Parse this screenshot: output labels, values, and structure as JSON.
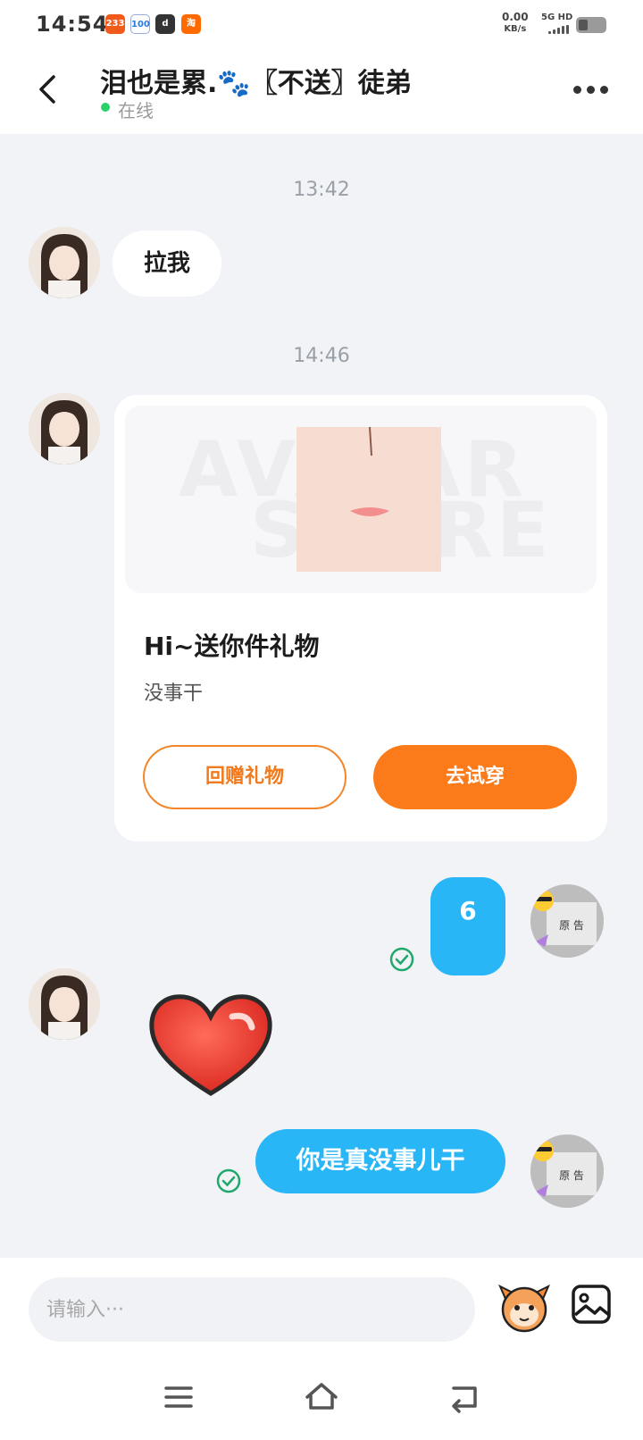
{
  "status_bar": {
    "time": "14:54",
    "apps": [
      "233",
      "100",
      "d",
      "淘"
    ],
    "net_speed_value": "0.00",
    "net_speed_unit": "KB/s",
    "signal_label": "5G HD",
    "battery_level": 0.25
  },
  "header": {
    "title": "泪也是累.🐾〖不送〗徒弟",
    "status": "在线"
  },
  "messages": {
    "time_1": "13:42",
    "msg_1_text": "拉我",
    "time_2": "14:46",
    "gift": {
      "banner_watermark_1": "AVATAR",
      "banner_watermark_2": "STORE",
      "title": "Hi~送你件礼物",
      "subtitle": "没事干",
      "return_gift_label": "回赠礼物",
      "try_on_label": "去试穿"
    },
    "msg_out_1": "6",
    "msg_out_2": "你是真没事儿干",
    "avatar_right_sign": "原 告"
  },
  "input_bar": {
    "placeholder": "请输入···"
  },
  "colors": {
    "accent_blue": "#29b6f6",
    "accent_orange": "#fb7a19",
    "online_green": "#2ad16b",
    "read_green": "#20a86b"
  }
}
